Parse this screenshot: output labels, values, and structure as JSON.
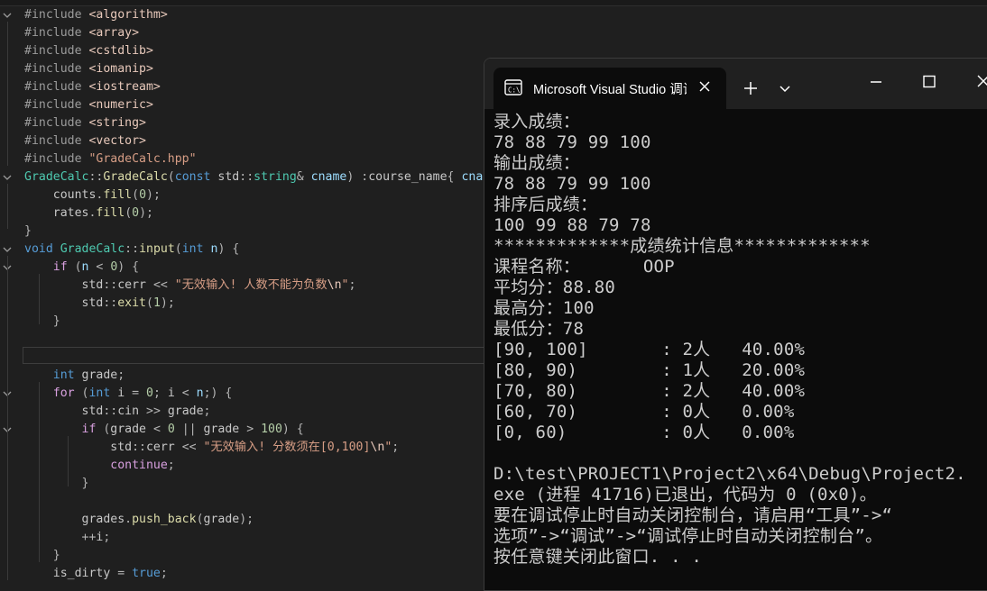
{
  "editor": {
    "lines": [
      [
        [
          "pp",
          "#include "
        ],
        [
          "inc",
          "<algorithm>"
        ]
      ],
      [
        [
          "pp",
          "#include "
        ],
        [
          "inc",
          "<array>"
        ]
      ],
      [
        [
          "pp",
          "#include "
        ],
        [
          "inc",
          "<cstdlib>"
        ]
      ],
      [
        [
          "pp",
          "#include "
        ],
        [
          "inc",
          "<iomanip>"
        ]
      ],
      [
        [
          "pp",
          "#include "
        ],
        [
          "inc",
          "<iostream>"
        ]
      ],
      [
        [
          "pp",
          "#include "
        ],
        [
          "inc",
          "<numeric>"
        ]
      ],
      [
        [
          "pp",
          "#include "
        ],
        [
          "inc",
          "<string>"
        ]
      ],
      [
        [
          "pp",
          "#include "
        ],
        [
          "inc",
          "<vector>"
        ]
      ],
      [
        [
          "pp",
          "#include "
        ],
        [
          "str",
          "\"GradeCalc.hpp\""
        ]
      ],
      [
        [
          "type",
          "GradeCalc"
        ],
        [
          "punc",
          "::"
        ],
        [
          "fn",
          "GradeCalc"
        ],
        [
          "punc",
          "("
        ],
        [
          "kw",
          "const "
        ],
        [
          "id",
          "std"
        ],
        [
          "punc",
          "::"
        ],
        [
          "type",
          "string"
        ],
        [
          "punc",
          "& "
        ],
        [
          "var",
          "cname"
        ],
        [
          "punc",
          ") :"
        ],
        [
          "id",
          "course_name"
        ],
        [
          "punc",
          "{ "
        ],
        [
          "var",
          "cna"
        ]
      ],
      [
        [
          "id",
          "    counts"
        ],
        [
          "punc",
          "."
        ],
        [
          "fn",
          "fill"
        ],
        [
          "punc",
          "("
        ],
        [
          "num",
          "0"
        ],
        [
          "punc",
          ");"
        ]
      ],
      [
        [
          "id",
          "    rates"
        ],
        [
          "punc",
          "."
        ],
        [
          "fn",
          "fill"
        ],
        [
          "punc",
          "("
        ],
        [
          "num",
          "0"
        ],
        [
          "punc",
          ");"
        ]
      ],
      [
        [
          "punc",
          "}"
        ]
      ],
      [
        [
          "kw",
          "void "
        ],
        [
          "type",
          "GradeCalc"
        ],
        [
          "punc",
          "::"
        ],
        [
          "fn",
          "input"
        ],
        [
          "punc",
          "("
        ],
        [
          "kw",
          "int "
        ],
        [
          "var",
          "n"
        ],
        [
          "punc",
          ") {"
        ]
      ],
      [
        [
          "kw2",
          "    if "
        ],
        [
          "punc",
          "("
        ],
        [
          "var",
          "n"
        ],
        [
          "punc",
          " < "
        ],
        [
          "num",
          "0"
        ],
        [
          "punc",
          ") {"
        ]
      ],
      [
        [
          "id",
          "        std"
        ],
        [
          "punc",
          "::"
        ],
        [
          "id",
          "cerr"
        ],
        [
          "punc",
          " << "
        ],
        [
          "str",
          "\"无效输入! 人数不能为负数"
        ],
        [
          "esc",
          "\\n"
        ],
        [
          "str",
          "\""
        ],
        [
          "punc",
          ";"
        ]
      ],
      [
        [
          "id",
          "        std"
        ],
        [
          "punc",
          "::"
        ],
        [
          "fn",
          "exit"
        ],
        [
          "punc",
          "("
        ],
        [
          "num",
          "1"
        ],
        [
          "punc",
          ");"
        ]
      ],
      [
        [
          "punc",
          "    }"
        ]
      ],
      [],
      [],
      [
        [
          "kw",
          "    int "
        ],
        [
          "id",
          "grade"
        ],
        [
          "punc",
          ";"
        ]
      ],
      [
        [
          "kw2",
          "    for "
        ],
        [
          "punc",
          "("
        ],
        [
          "kw",
          "int "
        ],
        [
          "id",
          "i"
        ],
        [
          "punc",
          " = "
        ],
        [
          "num",
          "0"
        ],
        [
          "punc",
          "; "
        ],
        [
          "id",
          "i"
        ],
        [
          "punc",
          " < "
        ],
        [
          "var",
          "n"
        ],
        [
          "punc",
          ";) {"
        ]
      ],
      [
        [
          "id",
          "        std"
        ],
        [
          "punc",
          "::"
        ],
        [
          "id",
          "cin"
        ],
        [
          "punc",
          " >> "
        ],
        [
          "id",
          "grade"
        ],
        [
          "punc",
          ";"
        ]
      ],
      [
        [
          "kw2",
          "        if "
        ],
        [
          "punc",
          "("
        ],
        [
          "id",
          "grade"
        ],
        [
          "punc",
          " < "
        ],
        [
          "num",
          "0"
        ],
        [
          "punc",
          " || "
        ],
        [
          "id",
          "grade"
        ],
        [
          "punc",
          " > "
        ],
        [
          "num",
          "100"
        ],
        [
          "punc",
          ") {"
        ]
      ],
      [
        [
          "id",
          "            std"
        ],
        [
          "punc",
          "::"
        ],
        [
          "id",
          "cerr"
        ],
        [
          "punc",
          " << "
        ],
        [
          "str",
          "\"无效输入! 分数须在[0,100]"
        ],
        [
          "esc",
          "\\n"
        ],
        [
          "str",
          "\""
        ],
        [
          "punc",
          ";"
        ]
      ],
      [
        [
          "kw2",
          "            continue"
        ],
        [
          "punc",
          ";"
        ]
      ],
      [
        [
          "punc",
          "        }"
        ]
      ],
      [],
      [
        [
          "id",
          "        grades"
        ],
        [
          "punc",
          "."
        ],
        [
          "fn",
          "push_back"
        ],
        [
          "punc",
          "("
        ],
        [
          "id",
          "grade"
        ],
        [
          "punc",
          ");"
        ]
      ],
      [
        [
          "punc",
          "        ++"
        ],
        [
          "id",
          "i"
        ],
        [
          "punc",
          ";"
        ]
      ],
      [
        [
          "punc",
          "    }"
        ]
      ],
      [
        [
          "id",
          "    is_dirty"
        ],
        [
          "punc",
          " = "
        ],
        [
          "kw",
          "true"
        ],
        [
          "punc",
          ";"
        ]
      ]
    ]
  },
  "terminal": {
    "tab_title": "Microsoft Visual Studio 调试控制台",
    "new_tab_symbol": "+",
    "lines": [
      "录入成绩：",
      "78 88 79 99 100",
      "输出成绩：",
      "78 88 79 99 100",
      "排序后成绩：",
      "100 99 88 79 78",
      "*************成绩统计信息*************",
      "课程名称：      OOP",
      "平均分：88.80",
      "最高分：100",
      "最低分：78",
      "[90, 100]       : 2人   40.00%",
      "[80, 90)        : 1人   20.00%",
      "[70, 80)        : 2人   40.00%",
      "[60, 70)        : 0人   0.00%",
      "[0, 60)         : 0人   0.00%",
      "",
      "D:\\test\\PROJECT1\\Project2\\x64\\Debug\\Project2.",
      "exe (进程 41716)已退出，代码为 0 (0x0)。",
      "要在调试停止时自动关闭控制台，请启用“工具”->“",
      "选项”->“调试”->“调试停止时自动关闭控制台”。",
      "按任意键关闭此窗口. . ."
    ]
  },
  "icons": {
    "terminal": "console-app-icon",
    "tab_close": "close-icon",
    "new_tab": "plus-icon",
    "dropdown": "chevron-down-icon",
    "minimize": "minimize-icon",
    "maximize": "maximize-icon",
    "window_close": "close-icon"
  }
}
